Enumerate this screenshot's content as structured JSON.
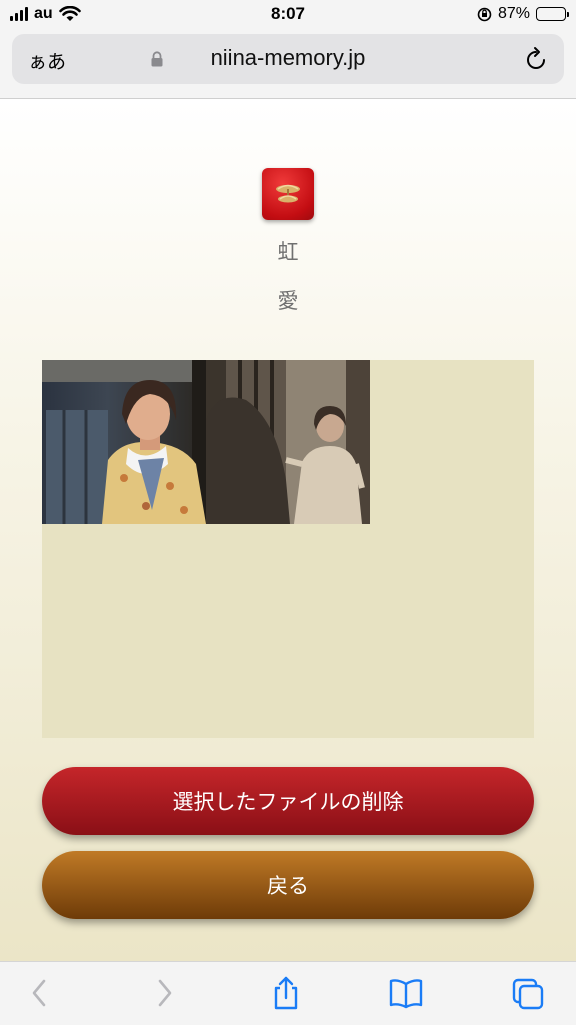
{
  "status_bar": {
    "carrier": "au",
    "time": "8:07",
    "battery_percent": "87%",
    "battery_level": 0.87
  },
  "address_bar": {
    "aa_label": "ぁあ",
    "url": "niina-memory.jp"
  },
  "page": {
    "name_char_1": "虹",
    "name_char_2": "愛",
    "delete_button_label": "選択したファイルの削除",
    "back_button_label": "戻る"
  },
  "colors": {
    "accent_red": "#b61b22",
    "accent_brown": "#a0601c",
    "gallery_bg": "#e7e2c2",
    "ios_blue": "#1a7cf6"
  },
  "icons": [
    "wifi-icon",
    "lock-icon",
    "reload-icon",
    "back-icon",
    "forward-icon",
    "share-icon",
    "bookmarks-icon",
    "tabs-icon"
  ]
}
